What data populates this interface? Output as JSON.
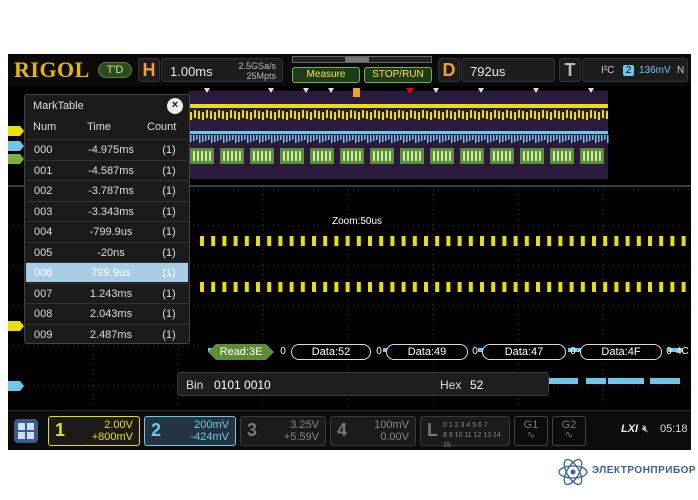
{
  "topbar": {
    "brand": "RIGOL",
    "trigger_status": "T'D",
    "horizontal_label": "H",
    "timebase": "1.00ms",
    "sample_rate": "2.5GSa/s",
    "memory_depth": "25Mpts",
    "measure_label": "Measure",
    "stop_run_label": "STOP/RUN",
    "delay_label": "D",
    "delay_value": "792us",
    "trigger_label": "T",
    "trigger_type": "I²C",
    "trigger_source": "2",
    "trigger_level": "136mV",
    "trigger_slope": "N"
  },
  "marktable": {
    "title": "MarkTable",
    "close_label": "×",
    "headers": {
      "num": "Num",
      "time": "Time",
      "count": "Count"
    },
    "rows": [
      {
        "num": "000",
        "time": "-4.975ms",
        "count": "(1)"
      },
      {
        "num": "001",
        "time": "-4.587ms",
        "count": "(1)"
      },
      {
        "num": "002",
        "time": "-3.787ms",
        "count": "(1)"
      },
      {
        "num": "003",
        "time": "-3.343ms",
        "count": "(1)"
      },
      {
        "num": "004",
        "time": "-799.9us",
        "count": "(1)"
      },
      {
        "num": "005",
        "time": "-20ns",
        "count": "(1)"
      },
      {
        "num": "006",
        "time": "799.9us",
        "count": "(1)"
      },
      {
        "num": "007",
        "time": "1.243ms",
        "count": "(1)"
      },
      {
        "num": "008",
        "time": "2.043ms",
        "count": "(1)"
      },
      {
        "num": "009",
        "time": "2.487ms",
        "count": "(1)"
      }
    ],
    "selected_index": 6
  },
  "zoom_label": "Zoom:50us",
  "decode": {
    "read": "Read:3E",
    "ack": [
      "0",
      "0",
      "0",
      "0",
      "0"
    ],
    "data": [
      "Data:52",
      "Data:49",
      "Data:47",
      "Data:4F"
    ],
    "tail": "4C"
  },
  "binbar": {
    "bin_label": "Bin",
    "bin_value": "0101 0010",
    "hex_label": "Hex",
    "hex_value": "52"
  },
  "channels": [
    {
      "num": "1",
      "scale": "2.00V",
      "offset": "+800mV",
      "color": "#e8e000"
    },
    {
      "num": "2",
      "scale": "200mV",
      "offset": "-424mV",
      "color": "#6ec6ea"
    },
    {
      "num": "3",
      "scale": "3.25V",
      "offset": "+5.59V",
      "color": "#777777"
    },
    {
      "num": "4",
      "scale": "100mV",
      "offset": "0.00V",
      "color": "#777777"
    }
  ],
  "logic": {
    "label": "L",
    "row1": "0 1 2 3 4 5 6 7",
    "row2": "8 9 10 11 12 13 14 15"
  },
  "generators": [
    "G1",
    "G2"
  ],
  "status": {
    "lxi": "LXI",
    "time": "05:18"
  },
  "watermark": "ЭЛЕКТРОНПРИБОР"
}
